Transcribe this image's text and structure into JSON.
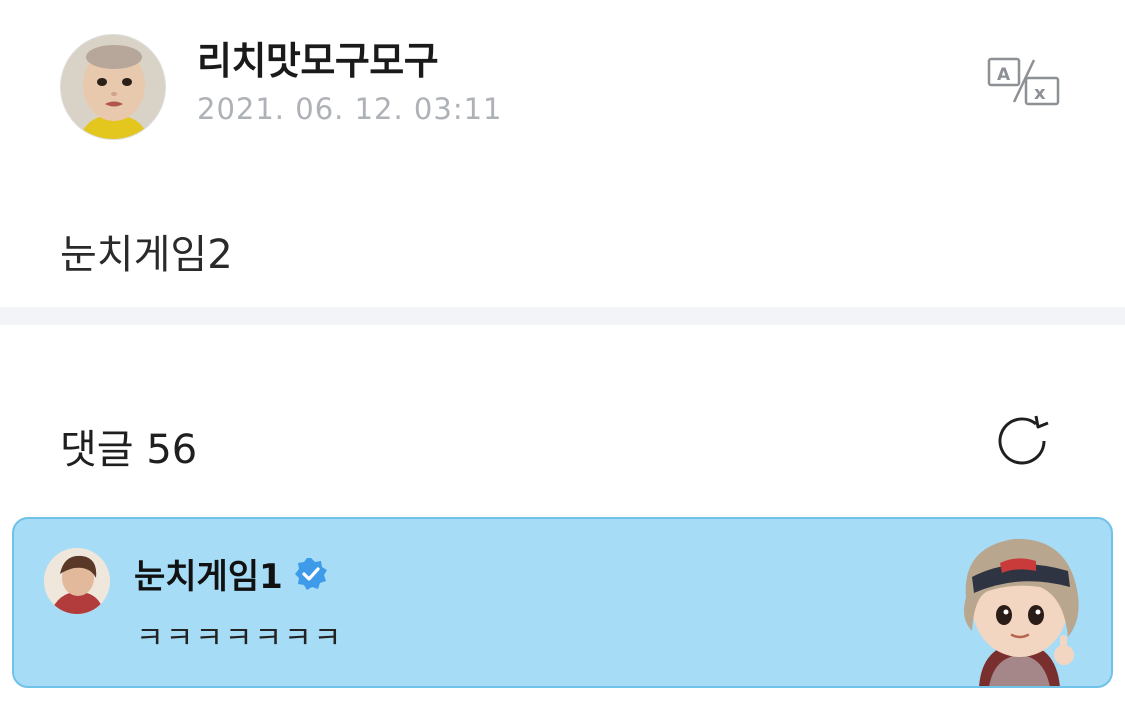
{
  "post": {
    "author_name": "리치맛모구모구",
    "timestamp": "2021. 06. 12. 03:11",
    "body_text": "눈치게임2",
    "translate_icon": "translate-icon"
  },
  "comments": {
    "title": "댓글 56",
    "refresh_icon": "refresh-icon",
    "items": [
      {
        "author": "눈치게임1",
        "verified": true,
        "text": "ㅋㅋㅋㅋㅋㅋㅋ",
        "sticker": "character-sticker"
      }
    ]
  },
  "colors": {
    "card_background": "#a7dcf6",
    "card_border": "#6fc2e8",
    "verified_badge": "#3d9be9",
    "timestamp_gray": "#aeb1b6",
    "divider": "#f2f4f8"
  }
}
